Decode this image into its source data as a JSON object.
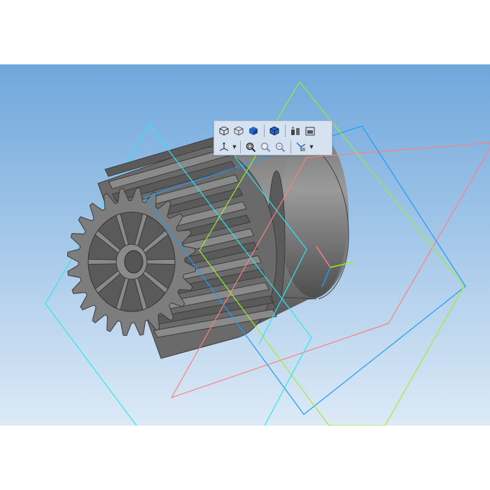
{
  "viewport": {
    "background_top": "#6fa7dc",
    "background_bottom": "#ddeaf6",
    "part_color": "#6b6b6b"
  },
  "toolbar": {
    "top_row": [
      "view-iso-icon",
      "view-wireframe-icon",
      "view-shaded-icon",
      "view-shaded-edges-icon",
      "perspective-icon",
      "section-view-icon"
    ],
    "bottom_row": [
      "orientation-axes-icon",
      "zoom-window-icon",
      "zoom-in-icon",
      "zoom-out-icon",
      "filter-selection-icon"
    ]
  },
  "planes": {
    "front_color": "#ff7f7f",
    "top_color": "#1a9cff",
    "right_color": "#9cef2a",
    "sketch_color": "#2ee6f0"
  }
}
